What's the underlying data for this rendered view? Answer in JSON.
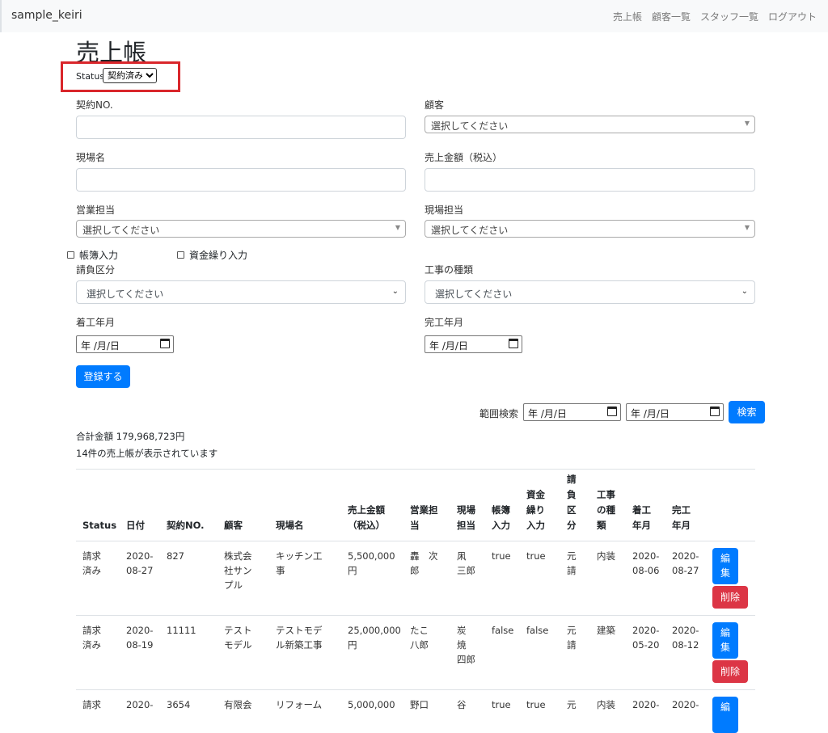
{
  "navbar": {
    "brand": "sample_keiri",
    "links": [
      "売上帳",
      "顧客一覧",
      "スタッフ一覧",
      "ログアウト"
    ]
  },
  "page_title": "売上帳",
  "status_filter": {
    "label": "Status",
    "selected": "契約済み"
  },
  "form": {
    "contract_no_label": "契約NO.",
    "customer_label": "顧客",
    "customer_placeholder": "選択してください",
    "site_name_label": "現場名",
    "sales_amount_label": "売上金額（税込）",
    "sales_staff_label": "営業担当",
    "sales_staff_placeholder": "選択してください",
    "site_staff_label": "現場担当",
    "site_staff_placeholder": "選択してください",
    "ledger_input_label": "帳簿入力",
    "funding_input_label": "資金繰り入力",
    "contract_type_label": "請負区分",
    "contract_type_placeholder": "選択してください",
    "work_type_label": "工事の種類",
    "work_type_placeholder": "選択してください",
    "start_month_label": "着工年月",
    "start_month_value": "年 /月/日",
    "end_month_label": "完工年月",
    "end_month_value": "年 /月/日",
    "register_button": "登録する"
  },
  "range_search": {
    "label": "範囲検索",
    "from_value": "年 /月/日",
    "to_value": "年 /月/日",
    "search_button": "検索"
  },
  "summary": {
    "total": "合計金額  179,968,723円",
    "count": "14件の売上帳が表示されています"
  },
  "table": {
    "headers": [
      [
        "Status"
      ],
      [
        "日付"
      ],
      [
        "契約NO."
      ],
      [
        "顧客"
      ],
      [
        "現場名"
      ],
      [
        "売上金額",
        "（税込）"
      ],
      [
        "営業担",
        "当"
      ],
      [
        "現場",
        "担当"
      ],
      [
        "帳簿",
        "入力"
      ],
      [
        "資金",
        "繰り",
        "入力"
      ],
      [
        "請",
        "負",
        "区",
        "分"
      ],
      [
        "工事",
        "の種",
        "類"
      ],
      [
        "着工",
        "年月"
      ],
      [
        "完工",
        "年月"
      ]
    ],
    "rows": [
      {
        "cells": [
          [
            "請求",
            "済み"
          ],
          [
            "2020-",
            "08-27"
          ],
          [
            "827"
          ],
          [
            "株式会",
            "社サン",
            "プル"
          ],
          [
            "キッチン工",
            "事"
          ],
          [
            "5,500,000",
            "円"
          ],
          [
            "轟　次",
            "郎"
          ],
          [
            "凩",
            "三郎"
          ],
          [
            "true"
          ],
          [
            "true"
          ],
          [
            "元",
            "請"
          ],
          [
            "内装"
          ],
          [
            "2020-",
            "08-06"
          ],
          [
            "2020-",
            "08-27"
          ]
        ],
        "edit": [
          "編",
          "集"
        ],
        "delete": "削除"
      },
      {
        "cells": [
          [
            "請求",
            "済み"
          ],
          [
            "2020-",
            "08-19"
          ],
          [
            "11111"
          ],
          [
            "テスト",
            "モデル"
          ],
          [
            "テストモデ",
            "ル新築工事"
          ],
          [
            "25,000,000",
            "円"
          ],
          [
            "たこ",
            "八郎"
          ],
          [
            "炭",
            "焼",
            "四郎"
          ],
          [
            "false"
          ],
          [
            "false"
          ],
          [
            "元",
            "請"
          ],
          [
            "建築"
          ],
          [
            "2020-",
            "05-20"
          ],
          [
            "2020-",
            "08-12"
          ]
        ],
        "edit": [
          "編",
          "集"
        ],
        "delete": "削除"
      },
      {
        "cells": [
          [
            "請求"
          ],
          [
            "2020-"
          ],
          [
            "3654"
          ],
          [
            "有限会"
          ],
          [
            "リフォーム"
          ],
          [
            "5,000,000"
          ],
          [
            "野口"
          ],
          [
            "谷"
          ],
          [
            "true"
          ],
          [
            "true"
          ],
          [
            "元"
          ],
          [
            "内装"
          ],
          [
            "2020-"
          ],
          [
            "2020-"
          ]
        ],
        "edit": [
          "編"
        ],
        "delete": ""
      }
    ]
  }
}
